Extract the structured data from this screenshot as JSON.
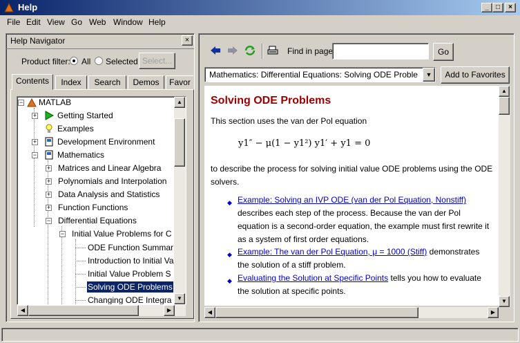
{
  "window": {
    "title": "Help"
  },
  "menu": [
    "File",
    "Edit",
    "View",
    "Go",
    "Web",
    "Window",
    "Help"
  ],
  "navigator": {
    "title": "Help Navigator",
    "product_filter_label": "Product filter:",
    "radio_all": "All",
    "radio_selected": "Selected",
    "select_button": "Select...",
    "tabs": [
      "Contents",
      "Index",
      "Search",
      "Demos",
      "Favor"
    ],
    "tree": [
      "MATLAB",
      "Getting Started",
      "Examples",
      "Development Environment",
      "Mathematics",
      "Matrices and Linear Algebra",
      "Polynomials and Interpolation",
      "Data Analysis and Statistics",
      "Function Functions",
      "Differential Equations",
      "Initial Value Problems for C",
      "ODE Function Summar",
      "Introduction to Initial Va",
      "Initial Value Problem S",
      "Solving ODE Problems",
      "Changing ODE  Integra"
    ]
  },
  "toolbar": {
    "find_label": "Find in page:",
    "find_value": "",
    "go_button": "Go",
    "location": "Mathematics: Differential Equations: Solving ODE Proble",
    "favorites_button": "Add to Favorites"
  },
  "content": {
    "heading": "Solving ODE Problems",
    "intro": "This section uses the van der Pol equation",
    "equation": "y1″ − μ(1 − y1²) y1′ + y1 = 0",
    "para": "to describe the process for solving initial value ODE problems using the ODE solvers.",
    "items": [
      {
        "link": "Example: Solving an IVP ODE (van der Pol Equation, Nonstiff)",
        "text": "describes each step of the process. Because the van der Pol equation is a second-order equation, the example must first rewrite it as a system of first order equations."
      },
      {
        "link": "Example: The van der Pol Equation, μ = 1000 (Stiff)",
        "text": "demonstrates the solution of a stiff problem."
      },
      {
        "link": "Evaluating the Solution at Specific Points",
        "text": "tells you how to evaluate the solution at specific points."
      }
    ]
  },
  "colors": {
    "title_bar": "#0a246a",
    "heading": "#990000",
    "link": "#0000cc",
    "selection": "#0a246a"
  }
}
